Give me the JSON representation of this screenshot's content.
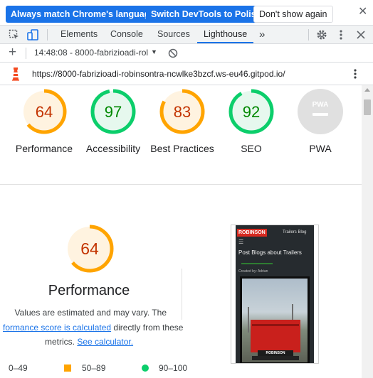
{
  "translate_bar": {
    "always_match_label": "Always match Chrome's language",
    "switch_label": "Switch DevTools to Polish",
    "dont_show_label": "Don't show again",
    "close_glyph": "✕"
  },
  "tabs": [
    {
      "label": "Elements"
    },
    {
      "label": "Console"
    },
    {
      "label": "Sources"
    },
    {
      "label": "Lighthouse"
    }
  ],
  "more_tabs_glyph": "»",
  "toolbar": {
    "add_glyph": "+",
    "report_selector": "14:48:08 - 8000-fabrizioadi-rol",
    "dropdown_glyph": "▼"
  },
  "urlbar": {
    "url": "https://8000-fabrizioadi-robinsontra-ncwlke3bzcf.ws-eu46.gitpod.io/"
  },
  "scores": [
    {
      "value": "64",
      "label": "Performance",
      "score": 64,
      "status": "average"
    },
    {
      "value": "97",
      "label": "Accessibility",
      "score": 97,
      "status": "pass"
    },
    {
      "value": "83",
      "label": "Best Practices",
      "score": 83,
      "status": "average"
    },
    {
      "value": "92",
      "label": "SEO",
      "score": 92,
      "status": "pass"
    },
    {
      "value": "PWA",
      "label": "PWA",
      "score": null,
      "status": "na"
    }
  ],
  "performance": {
    "value": "64",
    "score": 64,
    "title": "Performance",
    "desc_line1": "Values are estimated and may vary. The",
    "desc_link": "formance score is calculated",
    "desc_after_link": "directly from these",
    "desc_line3_prefix": "metrics.",
    "calc_link": "See calculator."
  },
  "legend": {
    "fail": "0–49",
    "average": "50–89",
    "pass": "90–100"
  },
  "screenshot": {
    "brand": "ROBINSON",
    "brand_suffix": "Trailers Blog",
    "menu_glyph": "☰",
    "heading": "Post Blogs about Trailers",
    "byline": "Created by: Adrian",
    "plate_text": "ROBINSON"
  },
  "colors": {
    "average": "#ffa400",
    "average_text": "#c33300",
    "average_fill": "#fff3e0",
    "pass": "#0cce6b",
    "pass_text": "#008800",
    "pass_fill": "#e6f8ee",
    "na": "#e0e0e0",
    "link": "#1a73e8",
    "fail": "#ff4e42"
  }
}
